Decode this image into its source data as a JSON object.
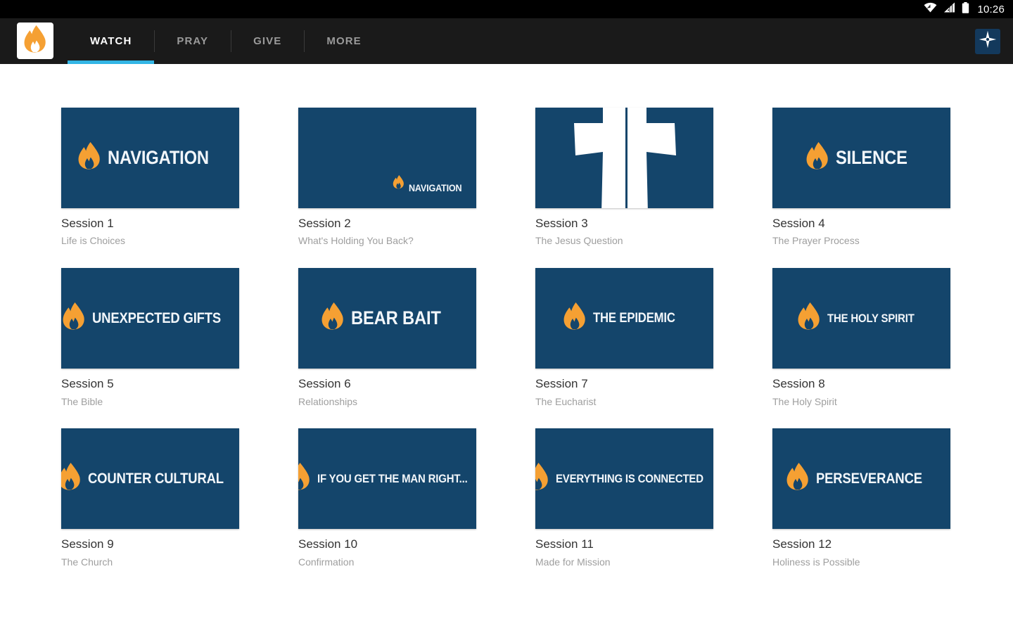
{
  "status_bar": {
    "time": "10:26",
    "icons": [
      "wifi-icon",
      "cellular-signal-icon",
      "battery-icon"
    ]
  },
  "action_bar": {
    "logo_icon": "flame-logo-icon",
    "tabs": [
      {
        "label": "WATCH",
        "active": true
      },
      {
        "label": "PRAY",
        "active": false
      },
      {
        "label": "GIVE",
        "active": false
      },
      {
        "label": "MORE",
        "active": false
      }
    ],
    "active_tab_indicator_color": "#33b5e5",
    "right_action_icon": "compass-star-icon"
  },
  "theme": {
    "thumb_background": "#14456b",
    "flame_orange": "#f5a033",
    "accent_blue": "#33b5e5",
    "action_bar_background": "#1a1a1a",
    "status_bar_background": "#000000",
    "page_background": "#ffffff",
    "title_color": "#333333",
    "subtitle_color": "#9e9e9e"
  },
  "sessions": [
    {
      "thumb_text": "NAVIGATION",
      "title": "Session 1",
      "subtitle": "Life is Choices",
      "layout": "center",
      "size": "s-reg"
    },
    {
      "thumb_text": "NAVIGATION",
      "title": "Session 2",
      "subtitle": "What's Holding You Back?",
      "layout": "corner",
      "size": "s-reg"
    },
    {
      "thumb_text": "",
      "title": "Session 3",
      "subtitle": "The Jesus Question",
      "layout": "cross",
      "size": "s-reg"
    },
    {
      "thumb_text": "SILENCE",
      "title": "Session 4",
      "subtitle": "The Prayer Process",
      "layout": "center",
      "size": "s-reg"
    },
    {
      "thumb_text": "UNEXPECTED GIFTS",
      "title": "Session 5",
      "subtitle": "The Bible",
      "layout": "center",
      "size": "s-long"
    },
    {
      "thumb_text": "BEAR BAIT",
      "title": "Session 6",
      "subtitle": "Relationships",
      "layout": "center",
      "size": "s-reg"
    },
    {
      "thumb_text": "THE EPIDEMIC",
      "title": "Session 7",
      "subtitle": "The Eucharist",
      "layout": "center",
      "size": "s-mlong"
    },
    {
      "thumb_text": "THE HOLY SPIRIT",
      "title": "Session 8",
      "subtitle": "The Holy Spirit",
      "layout": "center",
      "size": "s-xlong"
    },
    {
      "thumb_text": "COUNTER CULTURAL",
      "title": "Session 9",
      "subtitle": "The Church",
      "layout": "center",
      "size": "s-long"
    },
    {
      "thumb_text": "IF YOU GET THE MAN RIGHT...",
      "title": "Session 10",
      "subtitle": "Confirmation",
      "layout": "center",
      "size": "s-xlong"
    },
    {
      "thumb_text": "EVERYTHING IS CONNECTED",
      "title": "Session 11",
      "subtitle": "Made for Mission",
      "layout": "center",
      "size": "s-xlong"
    },
    {
      "thumb_text": "PERSEVERANCE",
      "title": "Session 12",
      "subtitle": "Holiness is Possible",
      "layout": "center",
      "size": "s-long"
    }
  ]
}
